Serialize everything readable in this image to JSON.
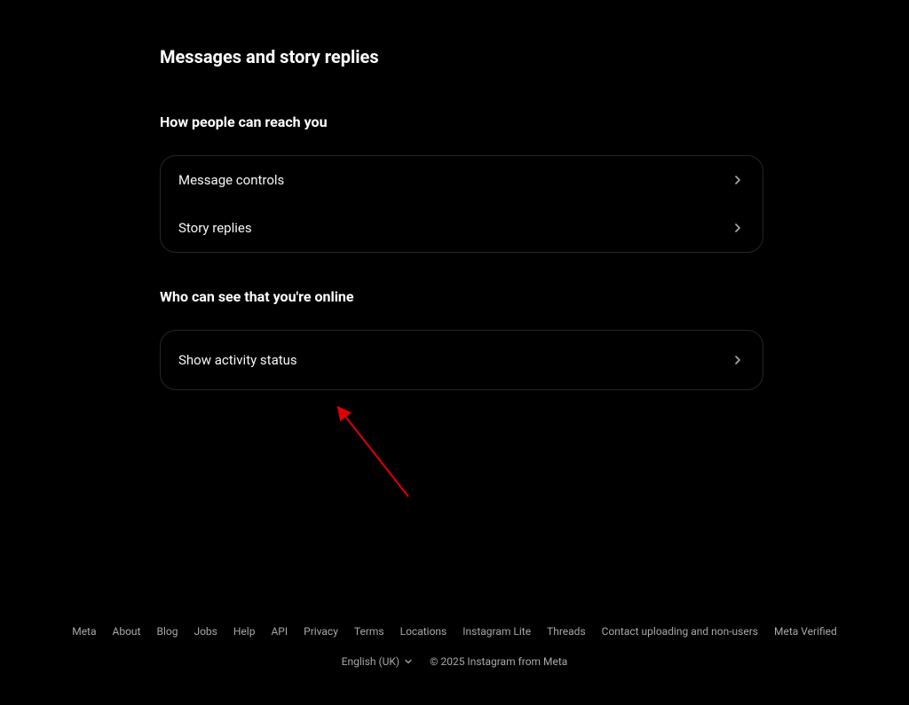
{
  "page": {
    "title": "Messages and story replies"
  },
  "sections": {
    "reach": {
      "title": "How people can reach you",
      "items": [
        {
          "label": "Message controls"
        },
        {
          "label": "Story replies"
        }
      ]
    },
    "online": {
      "title": "Who can see that you're online",
      "items": [
        {
          "label": "Show activity status"
        }
      ]
    }
  },
  "footer": {
    "links": [
      "Meta",
      "About",
      "Blog",
      "Jobs",
      "Help",
      "API",
      "Privacy",
      "Terms",
      "Locations",
      "Instagram Lite",
      "Threads",
      "Contact uploading and non-users",
      "Meta Verified"
    ],
    "language": "English (UK)",
    "copyright": "© 2025 Instagram from Meta"
  }
}
